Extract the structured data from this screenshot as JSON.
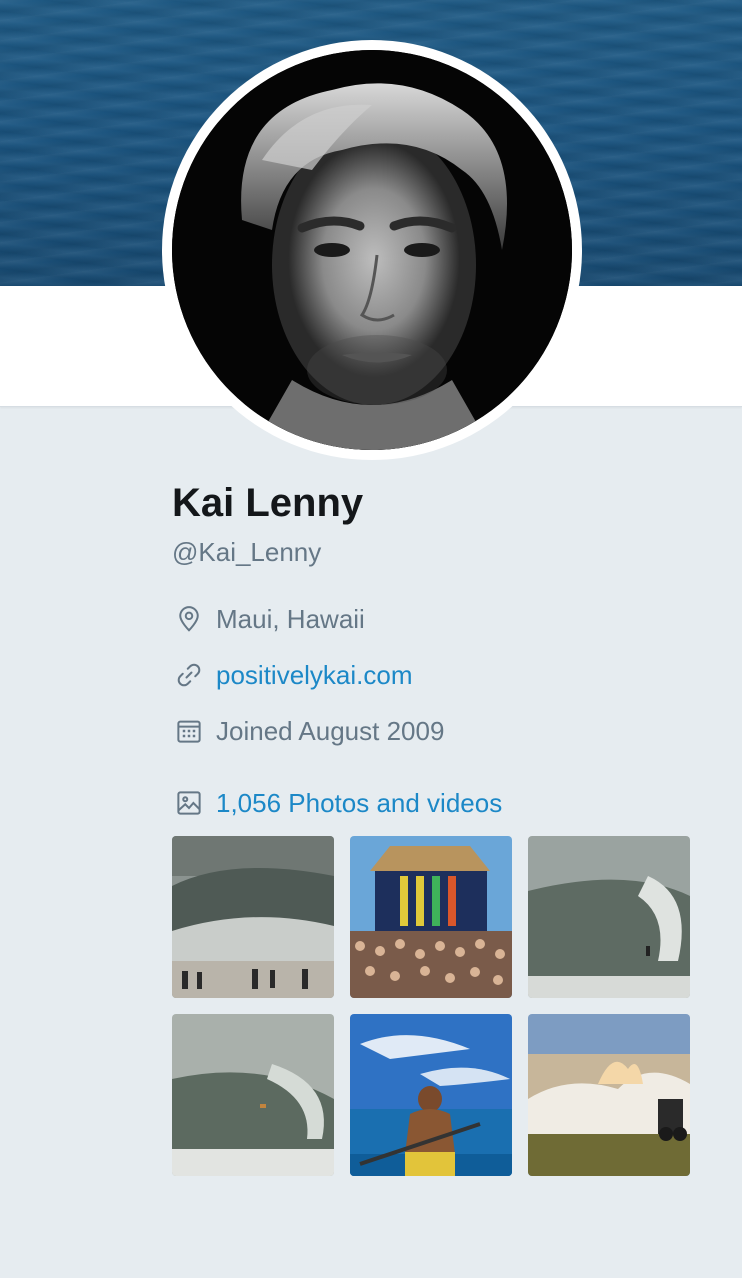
{
  "profile": {
    "name": "Kai Lenny",
    "handle": "@Kai_Lenny",
    "location": "Maui, Hawaii",
    "website": "positivelykai.com",
    "joined": "Joined August 2009",
    "photos_label": "1,056 Photos and videos"
  },
  "icons": {
    "location": "location-pin-icon",
    "website": "link-icon",
    "joined": "calendar-icon",
    "photos": "image-icon"
  },
  "colors": {
    "background": "#e6ecf0",
    "link": "#1c88c7",
    "muted_text": "#657786",
    "name_text": "#14171a"
  },
  "media_thumbnails": [
    {
      "description": "wave breaking at beach with spectators"
    },
    {
      "description": "surf contest podium with crowd"
    },
    {
      "description": "surfer in barrel"
    },
    {
      "description": "large barreling wave"
    },
    {
      "description": "man on paddleboard in ocean"
    },
    {
      "description": "rider on ATV above clouds at sunset"
    }
  ]
}
